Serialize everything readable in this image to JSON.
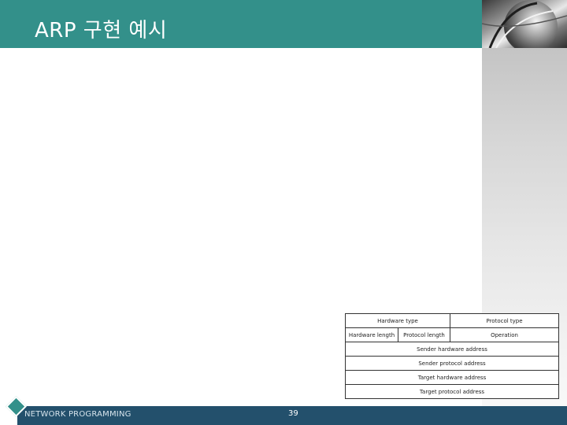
{
  "slide": {
    "title": "ARP 구현 예시",
    "footer": "NETWORK PROGRAMMING",
    "page_number": "39"
  },
  "arp_packet": {
    "hardware_type": "Hardware type",
    "protocol_type": "Protocol type",
    "hardware_length": "Hardware length",
    "protocol_length": "Protocol length",
    "operation": "Operation",
    "sender_hardware_address": "Sender hardware address",
    "sender_protocol_address": "Sender protocol address",
    "target_hardware_address": "Target hardware address",
    "target_protocol_address": "Target protocol address"
  },
  "colors": {
    "header": "#33908a",
    "footer_bar": "#23506c",
    "side_panel": "#d6d6d6"
  }
}
